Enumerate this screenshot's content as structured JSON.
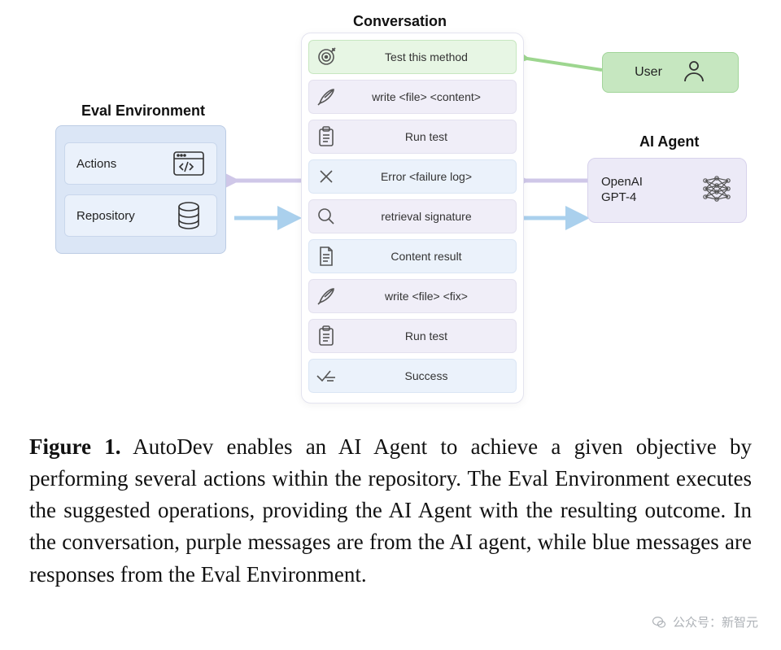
{
  "sections": {
    "eval": "Eval Environment",
    "conversation": "Conversation",
    "agent": "AI Agent"
  },
  "eval": {
    "actions": "Actions",
    "repository": "Repository"
  },
  "user": {
    "label": "User"
  },
  "agent": {
    "label": "OpenAI\nGPT-4"
  },
  "conversation": {
    "messages": [
      {
        "type": "green",
        "icon": "target",
        "text": "Test this method"
      },
      {
        "type": "purple",
        "icon": "quill",
        "text": "write <file> <content>"
      },
      {
        "type": "purple",
        "icon": "clipboard",
        "text": "Run test"
      },
      {
        "type": "blue",
        "icon": "x",
        "text": "Error <failure log>"
      },
      {
        "type": "purple",
        "icon": "search",
        "text": "retrieval signature"
      },
      {
        "type": "blue",
        "icon": "document",
        "text": "Content result"
      },
      {
        "type": "purple",
        "icon": "quill",
        "text": "write <file> <fix>"
      },
      {
        "type": "purple",
        "icon": "clipboard",
        "text": "Run test"
      },
      {
        "type": "blue",
        "icon": "check",
        "text": "Success"
      }
    ]
  },
  "caption": {
    "label": "Figure 1.",
    "text": "AutoDev enables an AI Agent to achieve a given objective by performing several actions within the repository. The Eval Environment executes the suggested operations, providing the AI Agent with the resulting outcome. In the conversation, purple messages are from the AI agent, while blue messages are responses from the Eval Environment."
  },
  "watermark": "公众号：新智元",
  "colors": {
    "green": "#c6e7c0",
    "purple": "#eceaf7",
    "blue": "#ebf2fb",
    "arrow_green": "#9dd68f",
    "arrow_purple": "#cfc7e8",
    "arrow_blue": "#aad0ed"
  }
}
